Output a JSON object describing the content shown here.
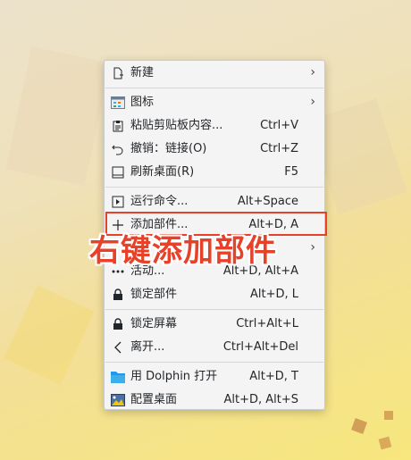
{
  "colors": {
    "accent_red": "#e8412a",
    "menu_bg": "#f4f4f5"
  },
  "menu": {
    "items": [
      {
        "label": "新建",
        "shortcut": "",
        "icon": "new-file-icon",
        "submenu": true
      },
      {
        "label": "图标",
        "shortcut": "",
        "icon": "icon-view-icon",
        "submenu": true
      },
      {
        "label": "粘贴剪贴板内容...",
        "shortcut": "Ctrl+V",
        "icon": "clipboard-icon",
        "submenu": false
      },
      {
        "label": "撤销：链接(O)",
        "shortcut": "Ctrl+Z",
        "icon": "undo-icon",
        "submenu": false
      },
      {
        "label": "刷新桌面(R)",
        "shortcut": "F5",
        "icon": "refresh-desktop-icon",
        "submenu": false
      },
      {
        "label": "运行命令...",
        "shortcut": "Alt+Space",
        "icon": "run-command-icon",
        "submenu": false
      },
      {
        "label": "添加部件...",
        "shortcut": "Alt+D, A",
        "icon": "plus-icon",
        "submenu": false
      },
      {
        "label": "",
        "shortcut": "",
        "icon": "",
        "submenu": true
      },
      {
        "label": "活动...",
        "shortcut": "Alt+D, Alt+A",
        "icon": "activities-icon",
        "submenu": false
      },
      {
        "label": "锁定部件",
        "shortcut": "Alt+D, L",
        "icon": "lock-icon",
        "submenu": false
      },
      {
        "label": "锁定屏幕",
        "shortcut": "Ctrl+Alt+L",
        "icon": "lock-icon",
        "submenu": false
      },
      {
        "label": "离开...",
        "shortcut": "Ctrl+Alt+Del",
        "icon": "chevron-left-icon",
        "submenu": false
      },
      {
        "label": "用 Dolphin 打开",
        "shortcut": "Alt+D, T",
        "icon": "folder-icon",
        "submenu": false
      },
      {
        "label": "配置桌面",
        "shortcut": "Alt+D, Alt+S",
        "icon": "configure-desktop-icon",
        "submenu": false
      }
    ]
  },
  "annotation": {
    "text": "右键添加部件"
  }
}
